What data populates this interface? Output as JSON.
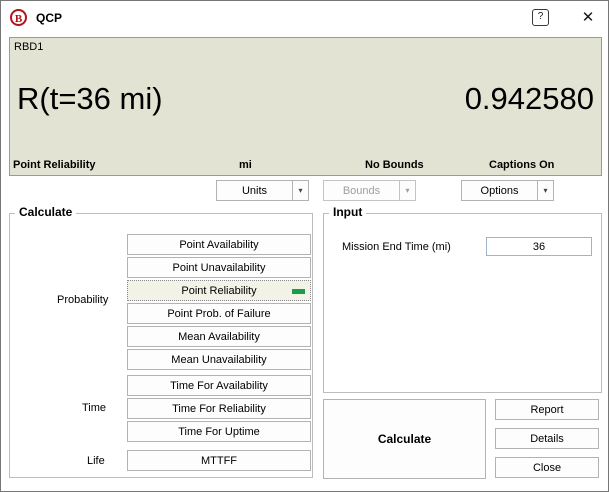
{
  "window": {
    "title": "QCP",
    "icon_letter": "B"
  },
  "icons": {
    "help": "?",
    "close": "✕",
    "dropdown": "▾"
  },
  "display": {
    "model": "RBD1",
    "expression": "R(t=36 mi)",
    "result": "0.942580",
    "metric": "Point Reliability",
    "units": "mi",
    "bounds": "No Bounds",
    "captions": "Captions On"
  },
  "toolbar": {
    "units": "Units",
    "bounds": "Bounds",
    "options": "Options"
  },
  "calc": {
    "title": "Calculate",
    "prob_label": "Probability",
    "prob": [
      "Point Availability",
      "Point Unavailability",
      "Point Reliability",
      "Point Prob. of Failure",
      "Mean Availability",
      "Mean Unavailability"
    ],
    "selected": "Point Reliability",
    "time_label": "Time",
    "time": [
      "Time For Availability",
      "Time For Reliability",
      "Time For Uptime"
    ],
    "life_label": "Life",
    "life": [
      "MTTFF"
    ]
  },
  "input": {
    "title": "Input",
    "label": "Mission End Time (mi)",
    "value": "36"
  },
  "actions": {
    "calculate": "Calculate",
    "report": "Report",
    "details": "Details",
    "close": "Close"
  },
  "colors": {
    "panel_bg": "#e3e3d3",
    "selected_indicator": "#189e4b",
    "disabled_text": "#9e9e9e"
  }
}
